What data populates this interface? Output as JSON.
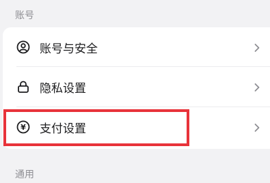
{
  "sections": {
    "account_title": "账号",
    "general_title": "通用"
  },
  "rows": [
    {
      "label": "账号与安全",
      "icon": "user-circle-icon"
    },
    {
      "label": "隐私设置",
      "icon": "lock-icon"
    },
    {
      "label": "支付设置",
      "icon": "yen-circle-icon"
    }
  ],
  "colors": {
    "background": "#f2f2f4",
    "card": "#ffffff",
    "text": "#1c1c1e",
    "section_title": "#8e8e93",
    "chevron": "#8e8e93",
    "highlight": "#e8333a"
  },
  "highlight": {
    "target": "支付设置"
  },
  "yen_glyph": "¥"
}
